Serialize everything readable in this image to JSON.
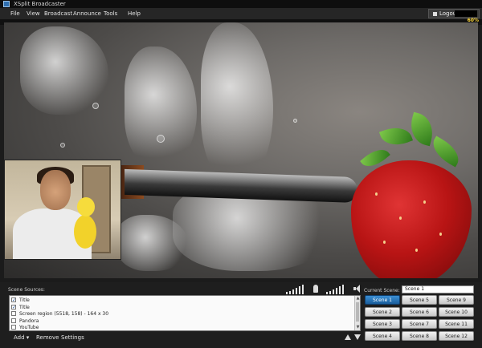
{
  "window": {
    "title": "XSplit Broadcaster"
  },
  "menu": [
    "File",
    "View",
    "Broadcast",
    "Announce",
    "Tools",
    "Help"
  ],
  "account": {
    "logout_label": "Logout"
  },
  "preview": {
    "fps": "60%"
  },
  "sources": {
    "label": "Scene Sources:",
    "items": [
      {
        "label": "Title",
        "checked": true
      },
      {
        "label": "Title",
        "checked": true
      },
      {
        "label": "Screen region (5518, 158) - 164 x 30",
        "checked": false
      },
      {
        "label": "Pandora",
        "checked": false
      },
      {
        "label": "YouTube",
        "checked": false
      }
    ],
    "toolbar": {
      "add": "Add",
      "remove": "Remove",
      "settings": "Settings"
    }
  },
  "audio": {
    "mic_level_bars": 6,
    "speaker_level_bars": 6
  },
  "scenes": {
    "current_label": "Current Scene:",
    "current_value": "Scene 1",
    "buttons": [
      "Scene 1",
      "Scene 5",
      "Scene 9",
      "Scene 2",
      "Scene 6",
      "Scene 10",
      "Scene 3",
      "Scene 7",
      "Scene 11",
      "Scene 4",
      "Scene 8",
      "Scene 12"
    ],
    "active_index": 0,
    "accent": "#2a78be"
  }
}
